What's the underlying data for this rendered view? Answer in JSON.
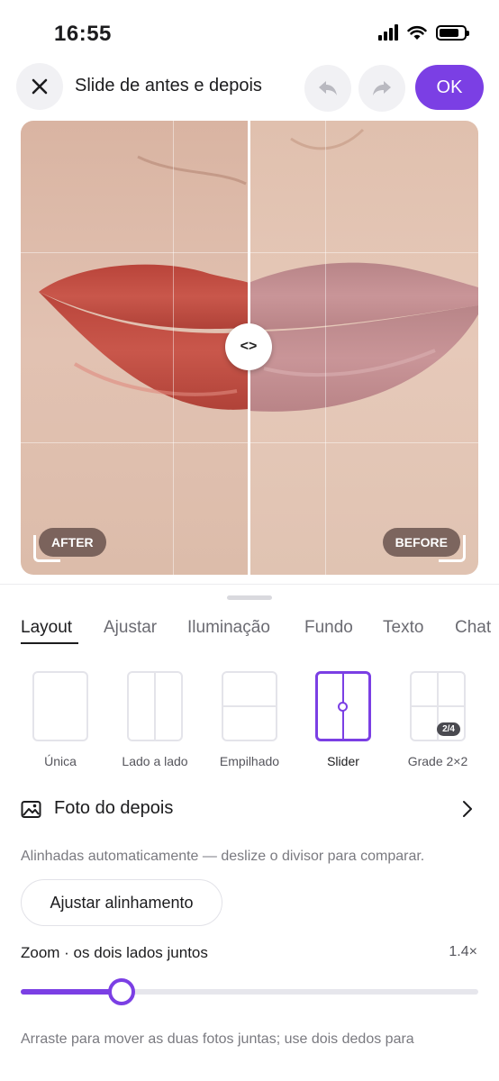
{
  "status_bar": {
    "time": "16:55",
    "icons": [
      "signal-icon",
      "wifi-icon",
      "battery-icon"
    ]
  },
  "header": {
    "title": "Slide de antes e depois",
    "close_icon": "close-icon",
    "undo_icon": "undo-icon",
    "redo_icon": "redo-icon",
    "ok_label": "OK"
  },
  "preview": {
    "left_label": "AFTER",
    "right_label": "BEFORE",
    "handle_label": "<>",
    "slider_position_fraction": 0.5
  },
  "tabs": [
    {
      "label": "Layout",
      "active": true
    },
    {
      "label": "Ajustar",
      "active": false
    },
    {
      "label": "Iluminação",
      "active": false
    },
    {
      "label": "Fundo",
      "active": false
    },
    {
      "label": "Texto",
      "active": false
    },
    {
      "label": "Chat",
      "active": false
    }
  ],
  "layouts": [
    {
      "label": "Única",
      "selected": false
    },
    {
      "label": "Lado a lado",
      "selected": false
    },
    {
      "label": "Empilhado",
      "selected": false
    },
    {
      "label": "Slider",
      "selected": true
    },
    {
      "label": "Grade 2×2",
      "selected": false,
      "badge": "2/4"
    }
  ],
  "after_photo": {
    "label": "Foto do depois",
    "icon": "image-icon",
    "chevron": "chevron-right-icon"
  },
  "alignment": {
    "hint": "Alinhadas automaticamente — deslize o divisor para comparar.",
    "button_label": "Ajustar alinhamento"
  },
  "zoom": {
    "label": "Zoom · os dois lados juntos",
    "value_text": "1.4×",
    "fraction": 0.22
  },
  "bottom_hint": "Arraste para mover as duas fotos juntas; use dois dedos para",
  "colors": {
    "accent": "#7b3fe4",
    "text": "#1c1c1e",
    "muted": "#7a7a80"
  }
}
